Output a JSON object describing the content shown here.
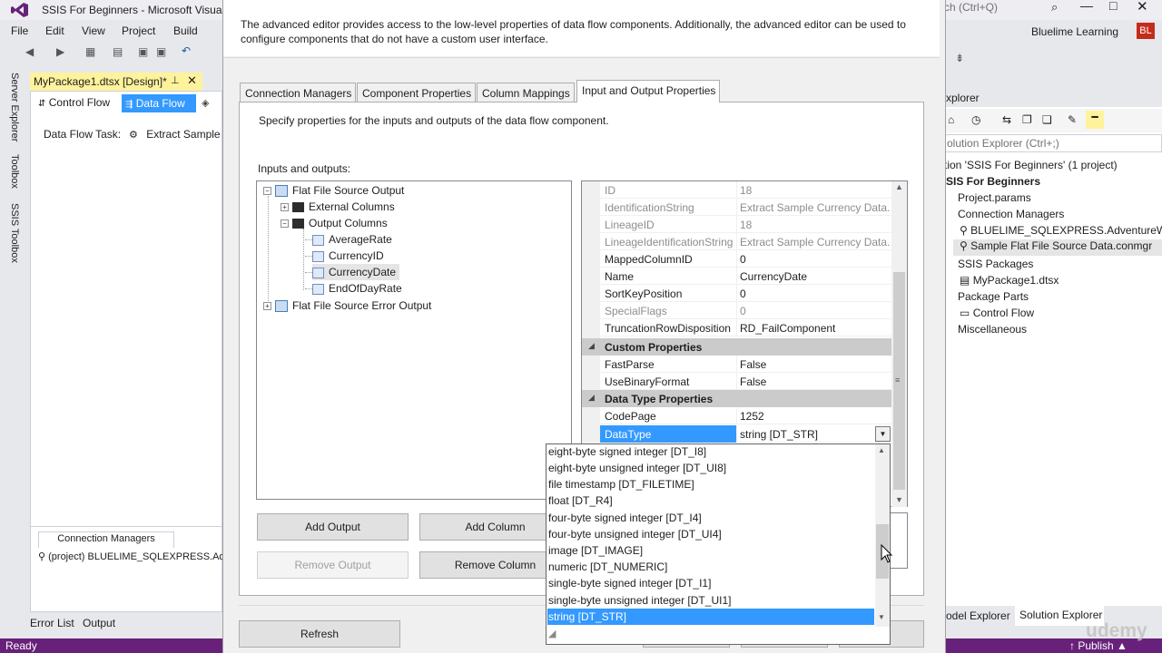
{
  "window": {
    "title": "SSIS For Beginners - Microsoft Visual",
    "quick_launch_placeholder": "ch (Ctrl+Q)",
    "account_name": "Bluelime Learning",
    "account_initials": "BL"
  },
  "menu": {
    "file": "File",
    "edit": "Edit",
    "view": "View",
    "project": "Project",
    "build": "Build"
  },
  "left_strip": {
    "server_explorer": "Server Explorer",
    "toolbox": "Toolbox",
    "ssis_toolbox": "SSIS Toolbox"
  },
  "document": {
    "tab_label": "MyPackage1.dtsx [Design]*",
    "tab_control_flow": "Control Flow",
    "tab_data_flow": "Data Flow",
    "data_flow_task_label": "Data Flow Task:",
    "data_flow_task_value": "Extract Sample"
  },
  "connection_managers": {
    "tab_label": "Connection Managers",
    "item": "(project) BLUELIME_SQLEXPRESS.Adve"
  },
  "bottom_tabs": {
    "error_list": "Error List",
    "output": "Output"
  },
  "status": {
    "text": "Ready",
    "publish": "↑ Publish ▲"
  },
  "watermark": "udemy",
  "solution_explorer": {
    "title": "xplorer",
    "search_placeholder": "olution Explorer (Ctrl+;)",
    "nodes": [
      "tion 'SSIS For Beginners' (1 project)",
      "SIS For Beginners",
      "Project.params",
      "Connection Managers",
      "BLUELIME_SQLEXPRESS.AdventureWor",
      "Sample Flat File Source Data.conmgr",
      "SSIS Packages",
      "MyPackage1.dtsx",
      "Package Parts",
      "Control Flow",
      "Miscellaneous"
    ],
    "tab_model_explorer": "odel Explorer",
    "tab_solution_explorer": "Solution Explorer"
  },
  "dialog": {
    "description": "The advanced editor provides access to the low-level properties of data flow components. Additionally, the advanced editor can be used to configure components that do not have a custom user interface.",
    "tabs": [
      "Connection Managers",
      "Component Properties",
      "Column Mappings",
      "Input and Output Properties"
    ],
    "panel_description": "Specify properties for the inputs and outputs of the data flow component.",
    "io_label": "Inputs and outputs:",
    "tree": {
      "flat_file_source_output": "Flat File Source Output",
      "external_columns": "External Columns",
      "output_columns": "Output Columns",
      "columns": [
        "AverageRate",
        "CurrencyID",
        "CurrencyDate",
        "EndOfDayRate"
      ],
      "flat_file_source_error_output": "Flat File Source Error Output"
    },
    "buttons": {
      "add_output": "Add Output",
      "add_column": "Add Column",
      "remove_output": "Remove Output",
      "remove_column": "Remove Column",
      "refresh": "Refresh"
    },
    "properties": {
      "rows": [
        {
          "name": "ID",
          "value": "18"
        },
        {
          "name": "IdentificationString",
          "value": "Extract Sample Currency Data.O"
        },
        {
          "name": "LineageID",
          "value": "18"
        },
        {
          "name": "LineageIdentificationString",
          "value": "Extract Sample Currency Data.O"
        },
        {
          "name": "MappedColumnID",
          "value": "0"
        },
        {
          "name": "Name",
          "value": "CurrencyDate"
        },
        {
          "name": "SortKeyPosition",
          "value": "0"
        },
        {
          "name": "SpecialFlags",
          "value": "0"
        },
        {
          "name": "TruncationRowDisposition",
          "value": "RD_FailComponent"
        }
      ],
      "custom_category": "Custom Properties",
      "custom_rows": [
        {
          "name": "FastParse",
          "value": "False"
        },
        {
          "name": "UseBinaryFormat",
          "value": "False"
        }
      ],
      "datatype_category": "Data Type Properties",
      "codepage": {
        "name": "CodePage",
        "value": "1252"
      },
      "datatype": {
        "name": "DataType",
        "value": "string [DT_STR]"
      }
    },
    "datatype_options": [
      "eight-byte signed integer [DT_I8]",
      "eight-byte unsigned integer [DT_UI8]",
      "file timestamp [DT_FILETIME]",
      "float [DT_R4]",
      "four-byte signed integer [DT_I4]",
      "four-byte unsigned integer [DT_UI4]",
      "image [DT_IMAGE]",
      "numeric [DT_NUMERIC]",
      "single-byte signed integer [DT_I1]",
      "single-byte unsigned integer [DT_UI1]",
      "string [DT_STR]"
    ]
  }
}
